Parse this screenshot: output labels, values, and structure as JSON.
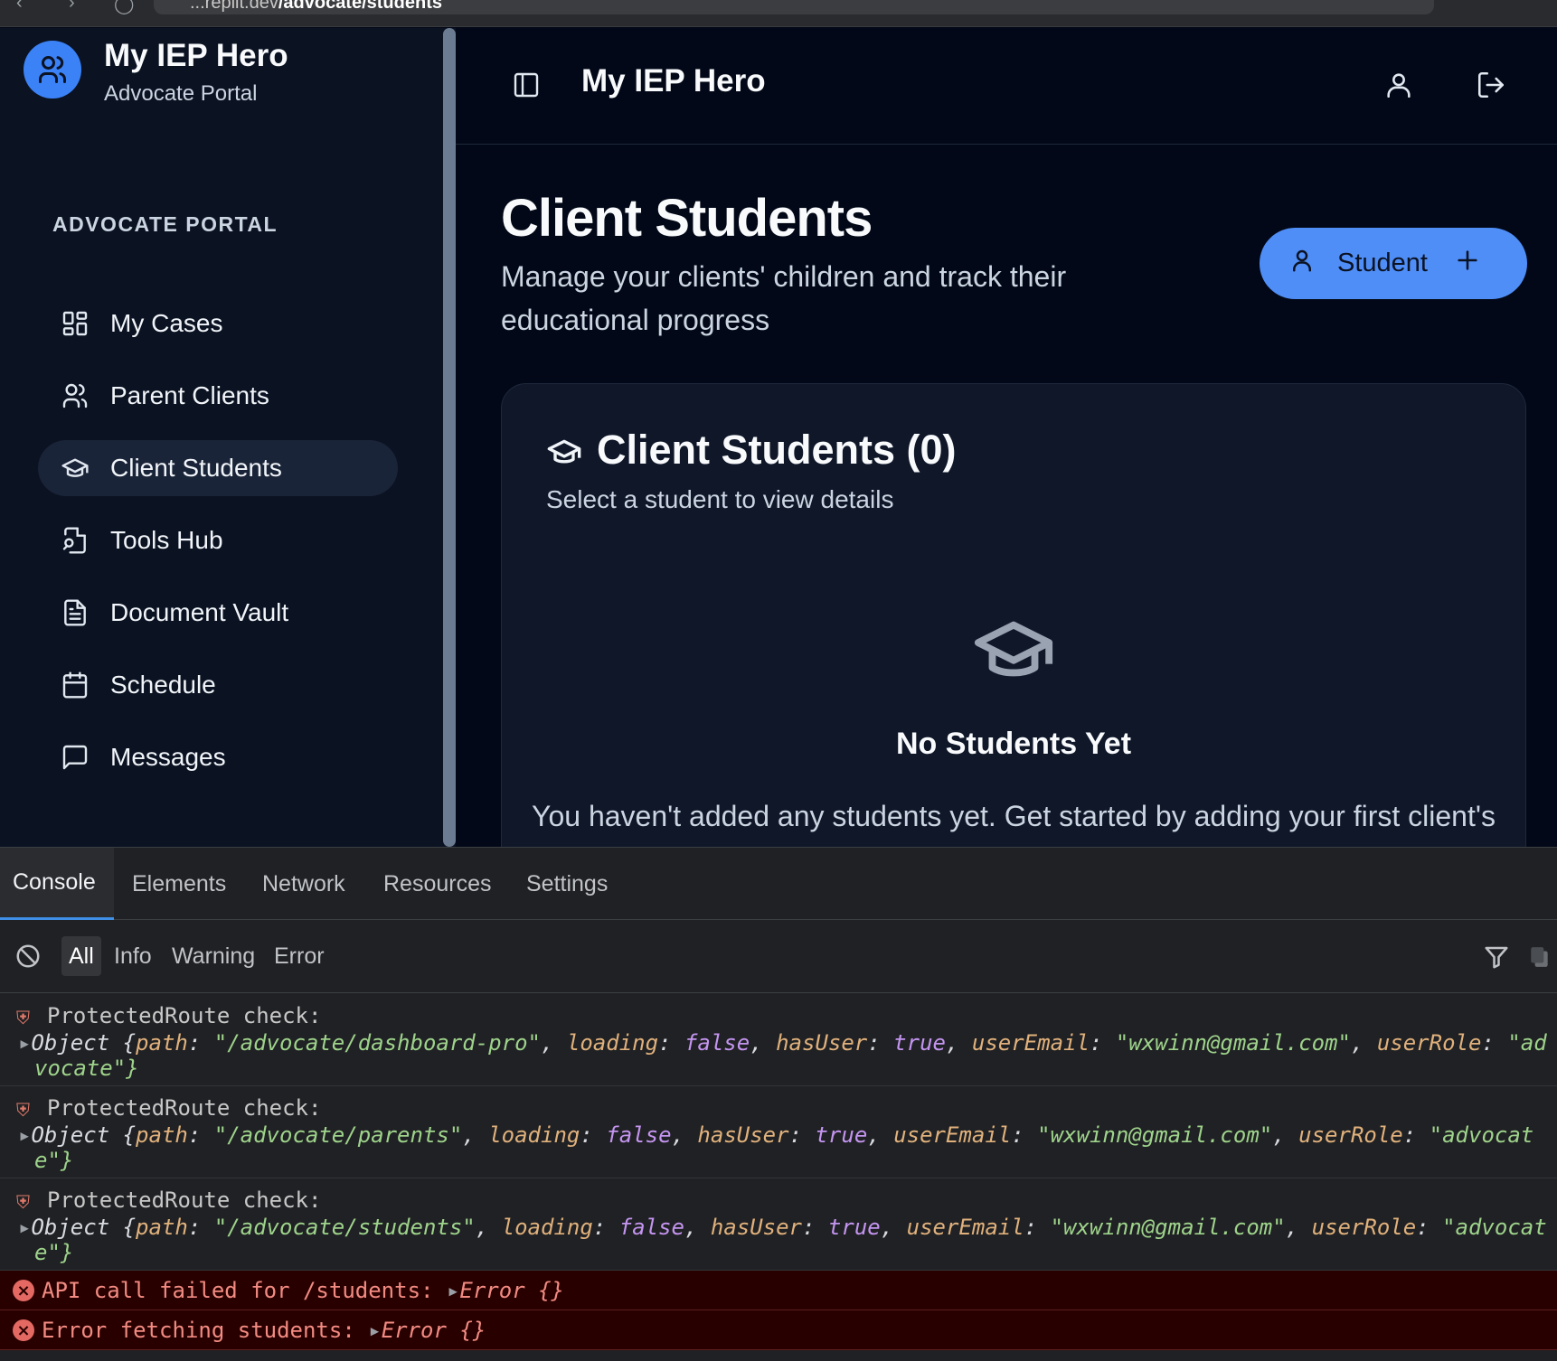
{
  "browser": {
    "url_prefix": "...replit.dev",
    "url_path": "/advocate/students"
  },
  "sidebar": {
    "brand_title": "My IEP Hero",
    "brand_subtitle": "Advocate Portal",
    "section_label": "ADVOCATE PORTAL",
    "items": [
      {
        "label": "My Cases",
        "icon": "grid-icon"
      },
      {
        "label": "Parent Clients",
        "icon": "users-icon"
      },
      {
        "label": "Client Students",
        "icon": "graduation-cap-icon",
        "active": true
      },
      {
        "label": "Tools Hub",
        "icon": "file-search-icon"
      },
      {
        "label": "Document Vault",
        "icon": "file-text-icon"
      },
      {
        "label": "Schedule",
        "icon": "calendar-icon"
      },
      {
        "label": "Messages",
        "icon": "message-icon"
      }
    ]
  },
  "header": {
    "title": "My IEP Hero"
  },
  "main": {
    "page_title": "Client Students",
    "page_description": "Manage your clients' children and track their educational progress",
    "add_button_label": "Student",
    "card": {
      "title": "Client Students (0)",
      "subtitle": "Select a student to view details",
      "empty_title": "No Students Yet",
      "empty_description": "You haven't added any students yet. Get started by adding your first client's student."
    }
  },
  "devtools": {
    "tabs": [
      "Console",
      "Elements",
      "Network",
      "Resources",
      "Settings"
    ],
    "filters": [
      "All",
      "Info",
      "Warning",
      "Error"
    ],
    "logs": [
      {
        "head": "ProtectedRoute check:",
        "line1": {
          "path": "\"/advocate/dashboard-pro\"",
          "loading": "false",
          "hasUser": "true",
          "userEmail": "\"wxwinn@gmail.com\"",
          "userRole_part": "\"ad"
        },
        "line2": "vocate\"}"
      },
      {
        "head": "ProtectedRoute check:",
        "line1": {
          "path": "\"/advocate/parents\"",
          "loading": "false",
          "hasUser": "true",
          "userEmail": "\"wxwinn@gmail.com\"",
          "userRole_part": "\"advocat"
        },
        "line2": "e\"}"
      },
      {
        "head": "ProtectedRoute check:",
        "line1": {
          "path": "\"/advocate/students\"",
          "loading": "false",
          "hasUser": "true",
          "userEmail": "\"wxwinn@gmail.com\"",
          "userRole_part": "\"advocat"
        },
        "line2": "e\"}"
      }
    ],
    "errors": [
      {
        "text": "API call failed for /students:",
        "obj": "Error {}"
      },
      {
        "text": "Error fetching students:",
        "obj": "Error {}"
      }
    ]
  }
}
